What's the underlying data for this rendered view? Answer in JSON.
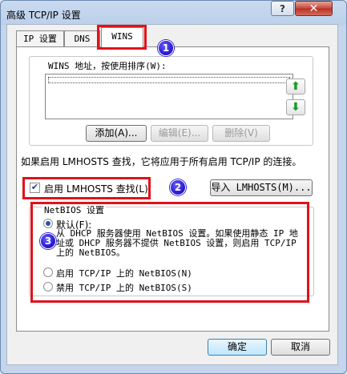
{
  "window": {
    "title": "高级 TCP/IP 设置",
    "help_label": "?",
    "close_label": "✕"
  },
  "tabs": [
    {
      "label": "IP 设置"
    },
    {
      "label": "DNS"
    },
    {
      "label": "WINS"
    }
  ],
  "badges": [
    "1",
    "2",
    "3"
  ],
  "wins": {
    "group_label": "WINS 地址，按使用排序(W):",
    "up_icon": "⬆",
    "down_icon": "⬇",
    "add_label": "添加(A)...",
    "edit_label": "编辑(E)...",
    "delete_label": "删除(V)"
  },
  "lmhosts": {
    "note": "如果启用 LMHOSTS 查找，它将应用于所有启用 TCP/IP 的连接。",
    "checkbox_label": "启用 LMHOSTS 查找(L)",
    "checked": true,
    "import_label": "导入 LMHOSTS(M)..."
  },
  "netbios": {
    "group_label": "NetBIOS 设置",
    "default_label": "默认(F):",
    "default_desc": "从 DHCP 服务器使用 NetBIOS 设置。如果使用静态 IP 地址或 DHCP 服务器不提供 NetBIOS 设置，则启用 TCP/IP 上的 NetBIOS。",
    "enable_label": "启用 TCP/IP 上的 NetBIOS(N)",
    "disable_label": "禁用 TCP/IP 上的 NetBIOS(S)",
    "selected": "default"
  },
  "footer": {
    "ok_label": "确定",
    "cancel_label": "取消"
  },
  "colors": {
    "highlight": "#e0121b",
    "badge": "#2a1dd0",
    "window_frame": "#c4d5ec"
  }
}
